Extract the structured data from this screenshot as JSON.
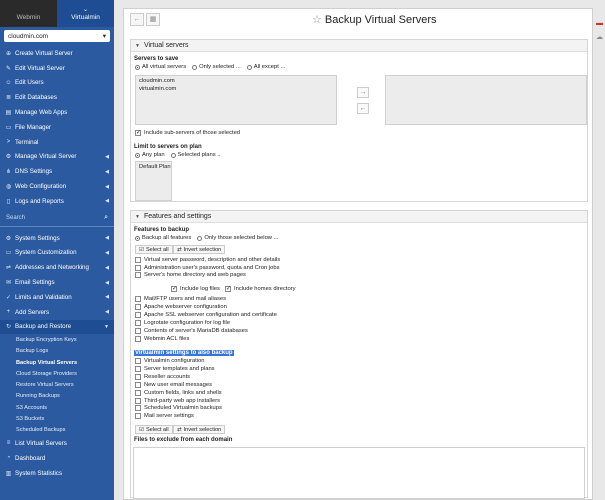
{
  "sidebar": {
    "tab_webmin": "Webmin",
    "tab_virtualmin": "Virtualmin",
    "selected_server": "cloudmin.com",
    "items_top": [
      {
        "label": "Create Virtual Server",
        "icon": "plus-circle-icon"
      },
      {
        "label": "Edit Virtual Server",
        "icon": "edit-icon"
      },
      {
        "label": "Edit Users",
        "icon": "user-icon"
      },
      {
        "label": "Edit Databases",
        "icon": "database-icon"
      },
      {
        "label": "Manage Web Apps",
        "icon": "apps-icon"
      },
      {
        "label": "File Manager",
        "icon": "folder-icon"
      },
      {
        "label": "Terminal",
        "icon": "terminal-icon"
      },
      {
        "label": "Manage Virtual Server",
        "icon": "gear-icon"
      },
      {
        "label": "DNS Settings",
        "icon": "sitemap-icon"
      },
      {
        "label": "Web Configuration",
        "icon": "globe-icon"
      },
      {
        "label": "Logs and Reports",
        "icon": "file-icon"
      }
    ],
    "search_placeholder": "Search",
    "items_mid": [
      {
        "label": "System Settings",
        "icon": "gear-icon"
      },
      {
        "label": "System Customization",
        "icon": "desktop-icon"
      },
      {
        "label": "Addresses and Networking",
        "icon": "network-icon"
      },
      {
        "label": "Email Settings",
        "icon": "envelope-icon"
      },
      {
        "label": "Limits and Validation",
        "icon": "check-icon"
      },
      {
        "label": "Add Servers",
        "icon": "plus-icon"
      },
      {
        "label": "Backup and Restore",
        "icon": "backup-icon"
      }
    ],
    "backup_subitems": [
      "Backup Encryption Keys",
      "Backup Logs",
      "Backup Virtual Servers",
      "Cloud Storage Providers",
      "Restore Virtual Servers",
      "Running Backups",
      "S3 Accounts",
      "S3 Buckets",
      "Scheduled Backups"
    ],
    "items_bottom": [
      {
        "label": "List Virtual Servers",
        "icon": "list-icon"
      },
      {
        "label": "Dashboard",
        "icon": "dashboard-icon"
      },
      {
        "label": "System Statistics",
        "icon": "chart-icon"
      }
    ]
  },
  "page": {
    "title": "Backup Virtual Servers"
  },
  "virtual_servers": {
    "heading": "Virtual servers",
    "servers_to_save_label": "Servers to save",
    "opt_all": "All virtual servers",
    "opt_selected": "Only selected ...",
    "opt_except": "All except ...",
    "servers": [
      "cloudmin.com",
      "virtualmin.com"
    ],
    "include_sub": "Include sub-servers of those selected",
    "limit_plan_label": "Limit to servers on plan",
    "opt_any_plan": "Any plan",
    "opt_selected_plans": "Selected plans ..",
    "plans": [
      "Default Plan"
    ]
  },
  "features": {
    "heading": "Features and settings",
    "features_label": "Features to backup",
    "opt_all_features": "Backup all features",
    "opt_selected_features": "Only those selected below ...",
    "select_all": "Select all",
    "invert_selection": "Invert selection",
    "feature_list_a": [
      "Virtual server password, description and other details",
      "Administration user's password, quota and Cron jobs",
      "Server's home directory and web pages"
    ],
    "include_log_files": "Include log files",
    "include_homes": "Include homes directory",
    "feature_list_b": [
      "Mail/FTP users and mail aliases",
      "Apache webserver configuration",
      "Apache SSL webserver configuration and certificate",
      "Logrotate configuration for log file",
      "Contents of server's MariaDB databases",
      "Webmin ACL files"
    ],
    "vm_settings_label": "Virtualmin settings to also backup",
    "vm_settings": [
      "Virtualmin configuration",
      "Server templates and plans",
      "Reseller accounts",
      "New user email messages",
      "Custom fields, links and shells",
      "Third-party web app installers",
      "Scheduled Virtualmin backups",
      "Mail server settings"
    ],
    "exclude_label": "Files to exclude from each domain"
  }
}
